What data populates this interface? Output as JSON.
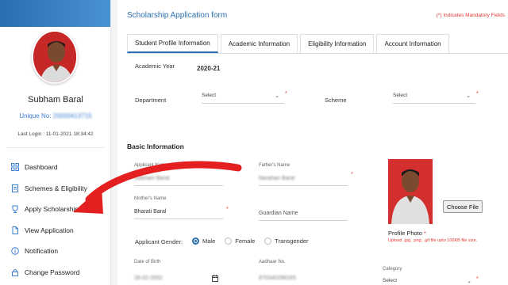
{
  "sidebar": {
    "name": "Subham Baral",
    "unique_label": "Unique No:",
    "unique_value": "20000413715",
    "last_login": "Last Login : 11-01-2021 18:34:42",
    "items": [
      {
        "label": "Dashboard",
        "icon": "grid-icon"
      },
      {
        "label": "Schemes & Eligibility",
        "icon": "document-icon"
      },
      {
        "label": "Apply Scholarship",
        "icon": "trophy-icon"
      },
      {
        "label": "View Application",
        "icon": "file-icon"
      },
      {
        "label": "Notification",
        "icon": "info-icon"
      },
      {
        "label": "Change Password",
        "icon": "lock-icon"
      }
    ]
  },
  "form": {
    "title": "Scholarship Application form",
    "mandatory_star": "(*)",
    "mandatory_note": "Indicates Mandatory Fields",
    "tabs": [
      "Student Profile Information",
      "Academic Information",
      "Eligibility Information",
      "Account Information"
    ],
    "academic_year_label": "Academic Year",
    "academic_year_value": "2020-21",
    "department_label": "Department",
    "department_value": "Select",
    "scheme_label": "Scheme",
    "scheme_value": "Select",
    "section_title": "Basic Information",
    "applicant_name_label": "Applicant Name",
    "applicant_name_value": "Subham Baral",
    "father_name_label": "Father's Name",
    "father_name_value": "Narahari Baral",
    "mother_name_label": "Mother's Name",
    "mother_name_value": "Bharati Baral",
    "guardian_name_placeholder": "Guardian Name",
    "gender_label": "Applicant Gender:",
    "gender_options": [
      "Male",
      "Female",
      "Transgender"
    ],
    "gender_selected": "Male",
    "dob_label": "Date of Birth",
    "dob_value": "28-02-2002",
    "aadhaar_label": "Aadhaar No.",
    "aadhaar_value": "870340298165",
    "category_label": "Category",
    "category_value": "Select",
    "choose_file_label": "Choose File",
    "photo_label": "Profile Photo",
    "upload_note": "Upload .jpg, .png, .gif file upto 100KB file size."
  },
  "colors": {
    "accent": "#2a6fb0",
    "required": "#e53935",
    "arrow": "#e41f1f"
  }
}
